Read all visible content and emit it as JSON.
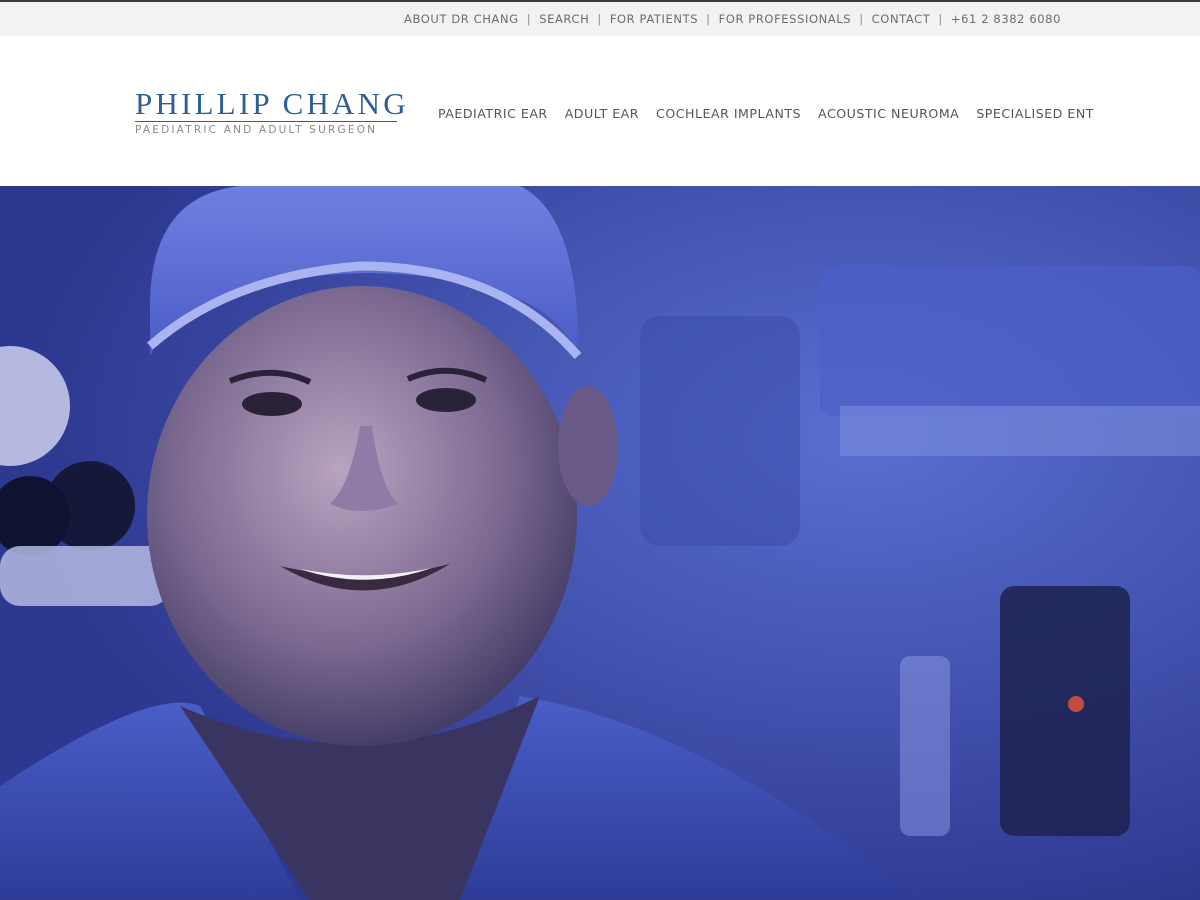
{
  "utility_nav": [
    {
      "label": "ABOUT DR CHANG"
    },
    {
      "label": "SEARCH"
    },
    {
      "label": "FOR PATIENTS"
    },
    {
      "label": "FOR PROFESSIONALS"
    },
    {
      "label": "CONTACT"
    },
    {
      "label": "+61 2 8382 6080"
    }
  ],
  "logo": {
    "name": "PHILLIP CHANG",
    "tagline": "PAEDIATRIC AND ADULT SURGEON"
  },
  "main_nav": [
    {
      "label": "PAEDIATRIC EAR"
    },
    {
      "label": "ADULT EAR"
    },
    {
      "label": "COCHLEAR IMPLANTS"
    },
    {
      "label": "ACOUSTIC NEUROMA"
    },
    {
      "label": "SPECIALISED ENT"
    }
  ],
  "hero": {
    "icon": "surgeon-portrait-photo"
  },
  "colors": {
    "brand_blue": "#2f5f97",
    "top_bar_bg": "#f2f2f2",
    "hero_blue": "#3a4bb0"
  }
}
